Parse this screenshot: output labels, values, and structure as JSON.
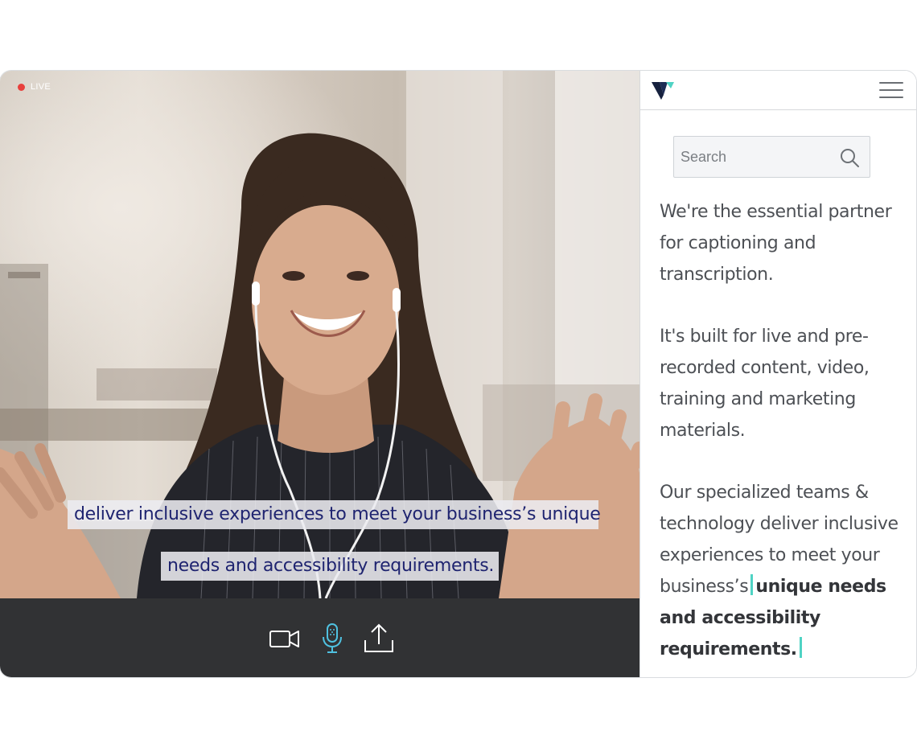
{
  "video": {
    "live_label": "LIVE",
    "captions": [
      "deliver inclusive experiences to meet your business’s unique",
      "needs and accessibility requirements."
    ]
  },
  "controls": {
    "camera_icon": "video-camera-icon",
    "mic_icon": "microphone-icon",
    "upload_icon": "upload-icon",
    "mic_color": "#4fc1e0"
  },
  "panel": {
    "logo_icon": "brand-logo-icon",
    "menu_icon": "hamburger-menu-icon",
    "search": {
      "placeholder": "Search",
      "value": ""
    },
    "paragraph1": "We're the essential partner for captioning and transcription.",
    "paragraph2": "It's built for live and pre-recorded content, video, training and marketing materials.",
    "paragraph3_plain": "Our specialized teams & technology deliver inclusive experiences to meet your business’s",
    "paragraph3_highlight": "unique needs and accessibility requirements.",
    "cursor_color": "#4fd3c4"
  },
  "colors": {
    "caption_text": "#1f2470",
    "control_bar": "#313234",
    "live_dot": "#e8403c"
  }
}
